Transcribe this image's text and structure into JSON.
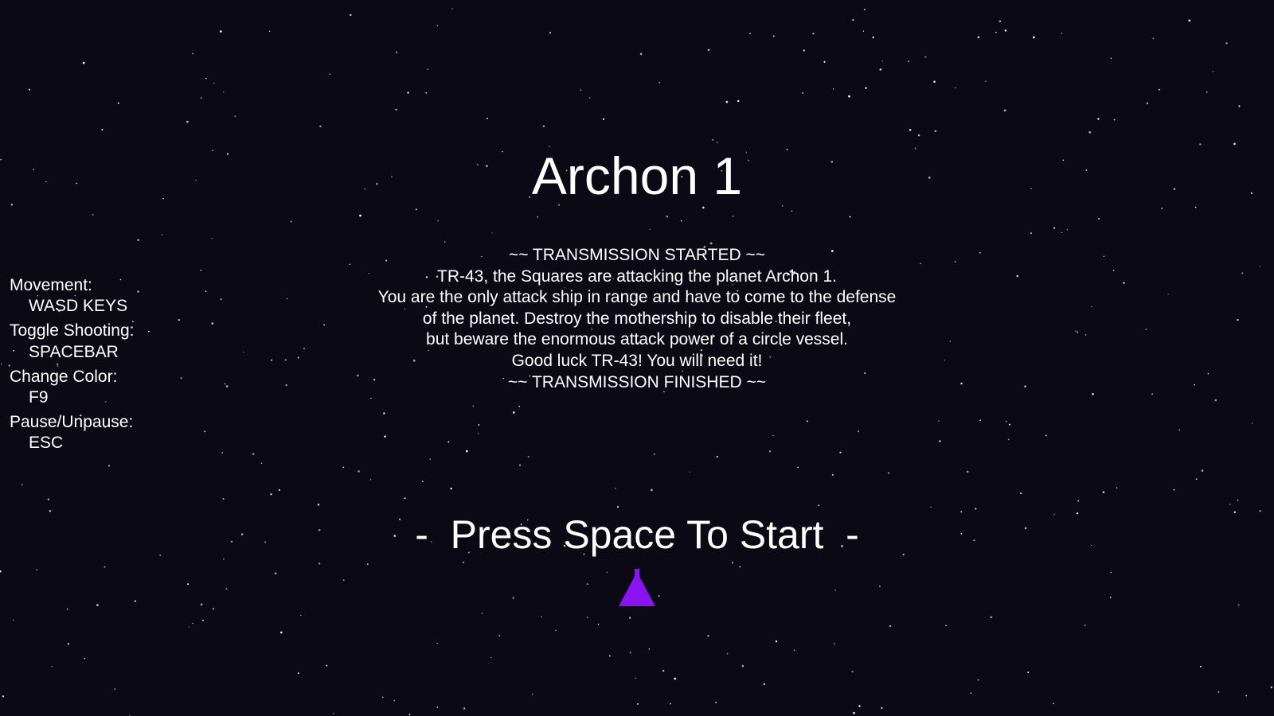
{
  "game": {
    "title": "Archon 1",
    "transmission": [
      "~~ TRANSMISSION STARTED ~~",
      "TR-43, the Squares are attacking the planet Archon 1.",
      "You are the only attack ship in range and have to come to the defense",
      "of the planet. Destroy the mothership to disable their fleet,",
      "but beware the enormous attack power of a circle vessel.",
      "Good luck TR-43! You will need it!",
      "~~ TRANSMISSION FINISHED ~~"
    ],
    "controls": [
      {
        "label": "Movement:",
        "key": "WASD KEYS"
      },
      {
        "label": "Toggle Shooting:",
        "key": "SPACEBAR"
      },
      {
        "label": "Change Color:",
        "key": "F9"
      },
      {
        "label": "Pause/Unpause:",
        "key": "ESC"
      }
    ],
    "start_prompt": "-  Press Space To Start  -",
    "ship_icon": "player-ship-icon",
    "colors": {
      "background": "#0b0a14",
      "text": "#ffffff",
      "ship": "#8a14f0",
      "stars": "#ffffff"
    }
  }
}
